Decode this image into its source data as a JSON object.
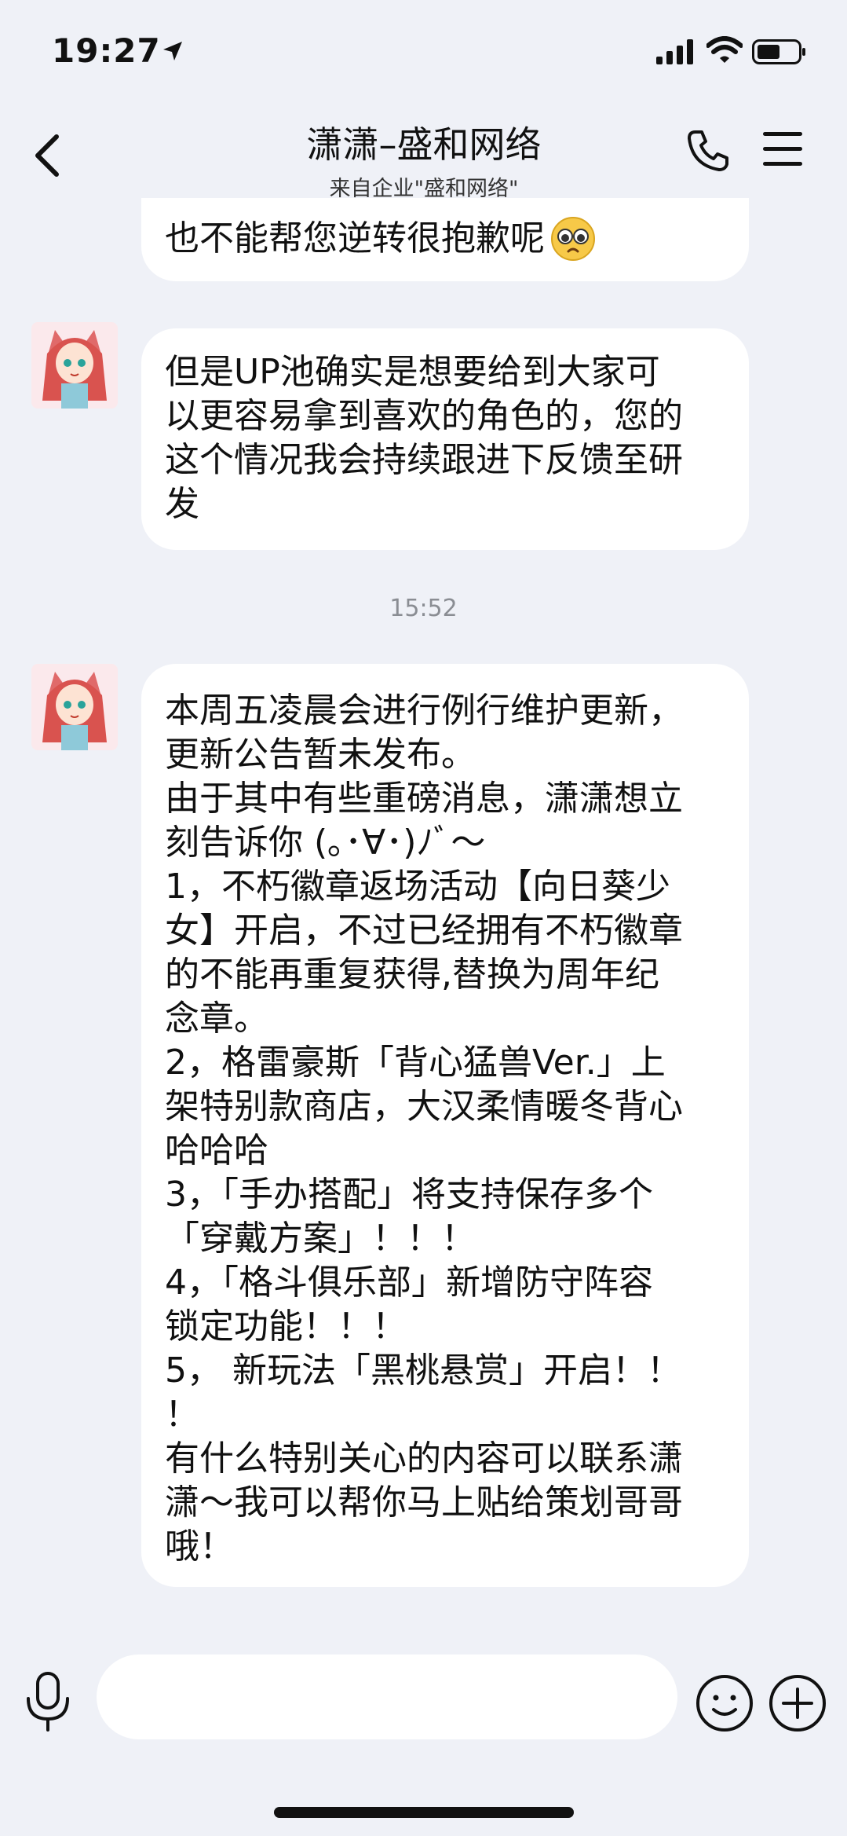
{
  "status_bar": {
    "time": "19:27"
  },
  "header": {
    "title": "潇潇–盛和网络",
    "subtitle": "来自企业\"盛和网络\""
  },
  "messages": [
    {
      "text": "也不能帮您逆转很抱歉呢",
      "emoji": "pleading-face-icon"
    },
    {
      "lines": [
        "但是UP池确实是想要给到大家可",
        "以更容易拿到喜欢的角色的，您的",
        "这个情况我会持续跟进下反馈至研",
        "发"
      ]
    },
    {
      "timestamp": "15:52"
    },
    {
      "lines": [
        "本周五凌晨会进行例行维护更新，",
        "更新公告暂未发布。",
        "由于其中有些重磅消息，潇潇想立",
        "刻告诉你 (｡･∀･)ﾉﾞ～",
        "1，不朽徽章返场活动【向日葵少",
        "女】开启，不过已经拥有不朽徽章",
        "的不能再重复获得,替换为周年纪",
        "念章。",
        "2，格雷豪斯「背心猛兽Ver.」上",
        "架特别款商店，大汉柔情暖冬背心",
        "哈哈哈",
        "3，「手办搭配」将支持保存多个",
        "「穿戴方案」！！！",
        "4，「格斗俱乐部」新增防守阵容",
        "锁定功能！！！",
        "5， 新玩法「黑桃悬赏」开启！！",
        "！",
        "有什么特别关心的内容可以联系潇",
        "潇～我可以帮你马上贴给策划哥哥",
        "哦！"
      ]
    }
  ],
  "input_bar": {
    "placeholder": ""
  },
  "colors": {
    "background": "#eff1f7",
    "bubble": "#ffffff",
    "timestamp": "#8a8d93"
  }
}
